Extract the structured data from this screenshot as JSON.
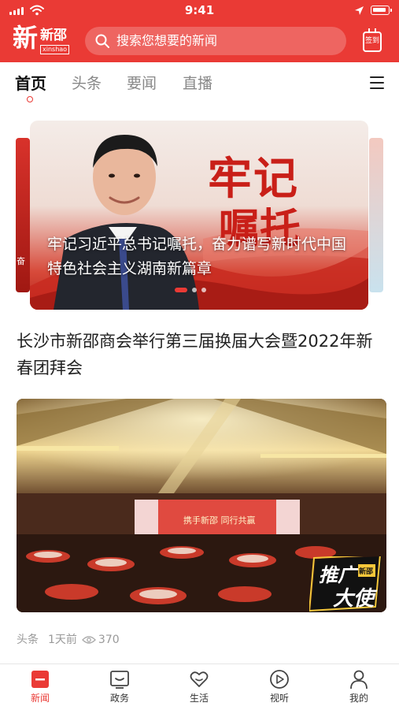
{
  "status_bar": {
    "time": "9:41"
  },
  "header": {
    "logo_big": "新",
    "logo_small": "新邵",
    "logo_pinyin": "xinshao",
    "search_placeholder": "搜索您想要的新闻",
    "signin_label": "签到"
  },
  "tabs": [
    {
      "label": "首页",
      "active": true
    },
    {
      "label": "头条",
      "active": false
    },
    {
      "label": "要闻",
      "active": false
    },
    {
      "label": "直播",
      "active": false
    }
  ],
  "carousel": {
    "side_left_text": "奋",
    "big_text_1": "牢记",
    "big_text_2": "嘱托",
    "caption": "牢记习近平总书记嘱托，奋力谱写新时代中国特色社会主义湖南新篇章",
    "page_count": 3,
    "active_page": 1
  },
  "article": {
    "headline": "长沙市新邵商会举行第三届换届大会暨2022年新春团拜会",
    "badge_text_1": "推广",
    "badge_text_2": "大使",
    "badge_small": "新邵",
    "stage_text": "携手新邵 同行共赢",
    "source": "头条",
    "time_ago": "1天前",
    "views": "370"
  },
  "bottom_nav": [
    {
      "label": "新闻",
      "icon": "news-icon",
      "active": true
    },
    {
      "label": "政务",
      "icon": "government-icon",
      "active": false
    },
    {
      "label": "生活",
      "icon": "heart-icon",
      "active": false
    },
    {
      "label": "视听",
      "icon": "play-icon",
      "active": false
    },
    {
      "label": "我的",
      "icon": "profile-icon",
      "active": false
    }
  ],
  "colors": {
    "brand_red": "#ea3a35",
    "text_dark": "#222222",
    "text_muted": "#999999"
  }
}
